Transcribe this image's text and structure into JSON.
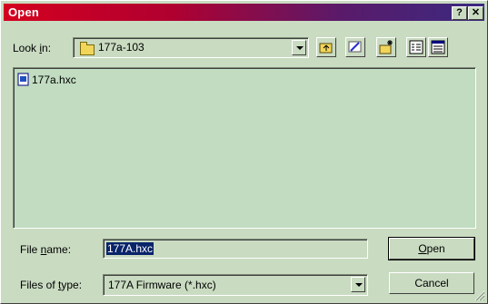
{
  "window": {
    "title": "Open"
  },
  "title_buttons": {
    "help": "?",
    "close": "✕"
  },
  "lookin": {
    "label_pre": "Look ",
    "label_u": "i",
    "label_post": "n:",
    "value": "177a-103"
  },
  "toolbar": [
    "up-one-level-icon",
    "desktop-icon",
    "create-new-folder-icon",
    "list-view-icon",
    "details-view-icon"
  ],
  "files": [
    {
      "name": "177a.hxc",
      "icon": "hxc-file-icon"
    }
  ],
  "filename": {
    "label_pre": "File ",
    "label_u": "n",
    "label_post": "ame:",
    "value": "177A.hxc"
  },
  "filetype": {
    "label_pre": "Files of ",
    "label_u": "t",
    "label_post": "ype:",
    "value": "177A Firmware (*.hxc)"
  },
  "buttons": {
    "open_u": "O",
    "open_rest": "pen",
    "cancel": "Cancel"
  },
  "colors": {
    "face": "#c9dbc1",
    "title_start": "#d4001f",
    "title_end": "#3a2a80",
    "selection": "#0a246a"
  }
}
